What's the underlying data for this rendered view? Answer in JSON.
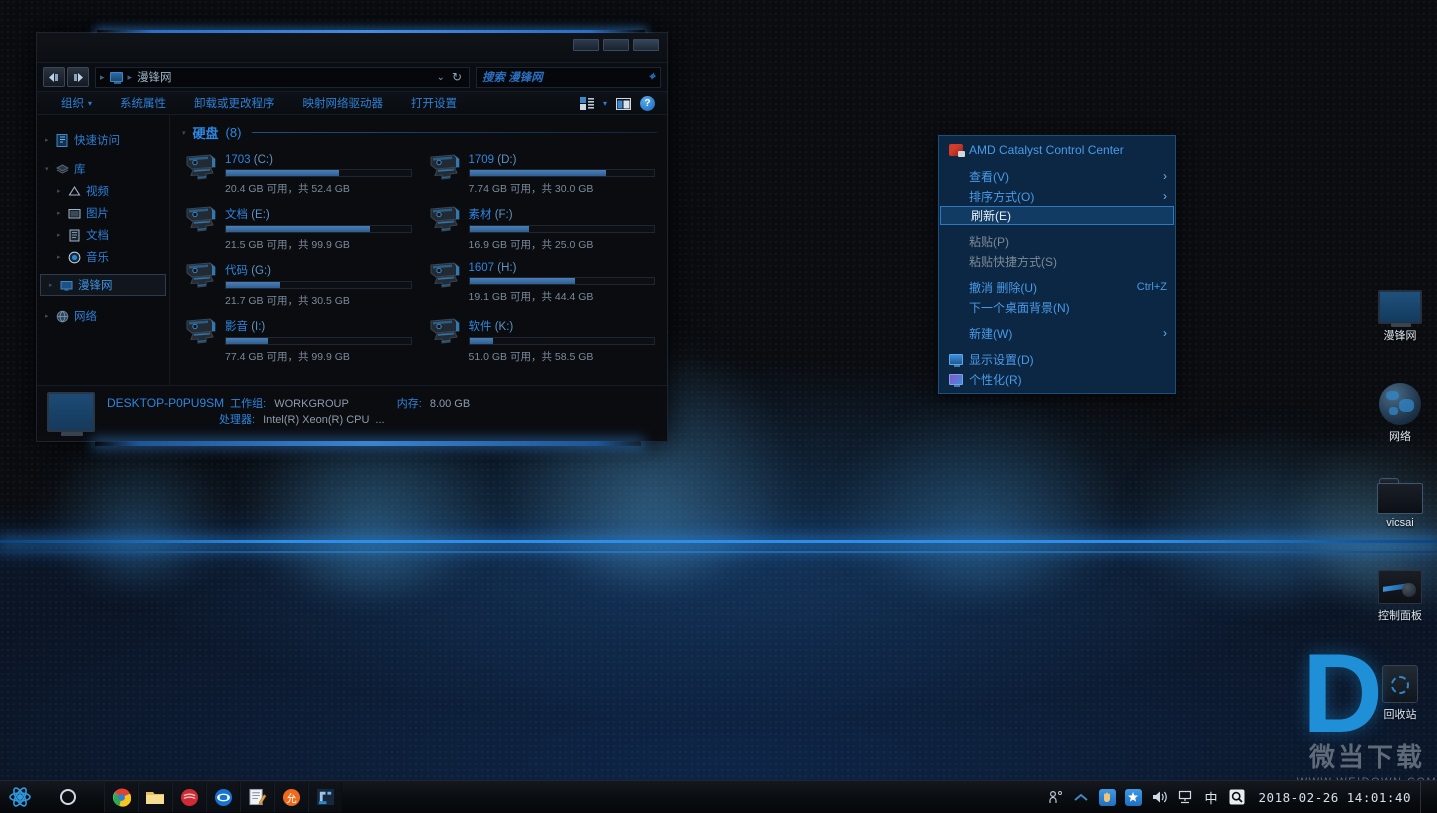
{
  "explorer": {
    "window_controls": [
      "minimize",
      "maximize",
      "close"
    ],
    "address": {
      "back_icon": "back-arrow-icon",
      "forward_icon": "forward-arrow-icon",
      "computer_icon": "computer-icon",
      "path": "漫锋网",
      "dropdown_icon": "chevron-down-icon",
      "refresh_icon": "refresh-icon",
      "search_placeholder": "搜索 漫锋网"
    },
    "commandbar": {
      "items": [
        {
          "label": "组织",
          "has_dropdown": true
        },
        {
          "label": "系统属性",
          "has_dropdown": false
        },
        {
          "label": "卸载或更改程序",
          "has_dropdown": false
        },
        {
          "label": "映射网络驱动器",
          "has_dropdown": false
        },
        {
          "label": "打开设置",
          "has_dropdown": false
        }
      ],
      "right_icons": [
        "view-layout-icon",
        "chevron-down-icon",
        "preview-pane-icon",
        "help-icon"
      ],
      "help_label": "?"
    },
    "navpane": {
      "items": [
        {
          "label": "快速访问",
          "icon": "quick-access-icon",
          "level": 1,
          "selected": false
        },
        {
          "label": "库",
          "icon": "library-icon",
          "level": 1,
          "selected": false
        },
        {
          "label": "视频",
          "icon": "videos-icon",
          "level": 2,
          "selected": false
        },
        {
          "label": "图片",
          "icon": "pictures-icon",
          "level": 2,
          "selected": false
        },
        {
          "label": "文档",
          "icon": "documents-icon",
          "level": 2,
          "selected": false
        },
        {
          "label": "音乐",
          "icon": "music-icon",
          "level": 2,
          "selected": false
        },
        {
          "label": "漫锋网",
          "icon": "computer-icon",
          "level": 1,
          "selected": true
        },
        {
          "label": "网络",
          "icon": "network-icon",
          "level": 1,
          "selected": false
        }
      ]
    },
    "group": {
      "title": "硬盘",
      "count": "(8)"
    },
    "drives": [
      {
        "name": "1703",
        "letter": "(C:)",
        "free": "20.4 GB 可用，共 52.4 GB",
        "used_pct": 61
      },
      {
        "name": "1709",
        "letter": "(D:)",
        "free": "7.74 GB 可用，共 30.0 GB",
        "used_pct": 74
      },
      {
        "name": "文档",
        "letter": "(E:)",
        "free": "21.5 GB 可用，共 99.9 GB",
        "used_pct": 78
      },
      {
        "name": "素材",
        "letter": "(F:)",
        "free": "16.9 GB 可用，共 25.0 GB",
        "used_pct": 32
      },
      {
        "name": "代码",
        "letter": "(G:)",
        "free": "21.7 GB 可用，共 30.5 GB",
        "used_pct": 29
      },
      {
        "name": "1607",
        "letter": "(H:)",
        "free": "19.1 GB 可用，共 44.4 GB",
        "used_pct": 57
      },
      {
        "name": "影音",
        "letter": "(I:)",
        "free": "77.4 GB 可用，共 99.9 GB",
        "used_pct": 23
      },
      {
        "name": "软件",
        "letter": "(K:)",
        "free": "51.0 GB 可用，共 58.5 GB",
        "used_pct": 13
      }
    ],
    "status": {
      "computer_name": "DESKTOP-P0PU9SM",
      "workgroup_label": "工作组:",
      "workgroup_value": "WORKGROUP",
      "memory_label": "内存:",
      "memory_value": "8.00 GB",
      "cpu_label": "处理器:",
      "cpu_value": "Intel(R) Xeon(R) CPU",
      "cpu_ellipsis": "..."
    }
  },
  "context_menu": {
    "items": [
      {
        "label": "AMD Catalyst Control Center",
        "icon": "amd-icon",
        "style": "link",
        "submenu": false,
        "accel": ""
      },
      {
        "label": "查看(V)",
        "icon": "",
        "style": "link",
        "submenu": true,
        "accel": ""
      },
      {
        "label": "排序方式(O)",
        "icon": "",
        "style": "link",
        "submenu": true,
        "accel": ""
      },
      {
        "label": "刷新(E)",
        "icon": "",
        "style": "highlight",
        "submenu": false,
        "accel": ""
      },
      {
        "label": "粘贴(P)",
        "icon": "",
        "style": "disabled",
        "submenu": false,
        "accel": ""
      },
      {
        "label": "粘贴快捷方式(S)",
        "icon": "",
        "style": "disabled",
        "submenu": false,
        "accel": ""
      },
      {
        "label": "撤消 删除(U)",
        "icon": "",
        "style": "link",
        "submenu": false,
        "accel": "Ctrl+Z"
      },
      {
        "label": "下一个桌面背景(N)",
        "icon": "",
        "style": "link",
        "submenu": false,
        "accel": ""
      },
      {
        "label": "新建(W)",
        "icon": "",
        "style": "link",
        "submenu": true,
        "accel": ""
      },
      {
        "label": "显示设置(D)",
        "icon": "display-settings-icon",
        "style": "link",
        "submenu": false,
        "accel": ""
      },
      {
        "label": "个性化(R)",
        "icon": "personalize-icon",
        "style": "link",
        "submenu": false,
        "accel": ""
      }
    ]
  },
  "desktop_icons": [
    {
      "label": "漫锋网",
      "icon": "computer-icon"
    },
    {
      "label": "网络",
      "icon": "network-globe-icon"
    },
    {
      "label": "vicsai",
      "icon": "folder-icon"
    },
    {
      "label": "控制面板",
      "icon": "control-panel-icon"
    },
    {
      "label": "回收站",
      "icon": "recycle-bin-icon"
    }
  ],
  "watermark": {
    "logo": "D",
    "title": "微当下载",
    "url": "WWW.WEIDOWN.COM"
  },
  "taskbar": {
    "start_icon": "start-atom-icon",
    "cortana_icon": "cortana-circle-icon",
    "buttons": [
      {
        "icon": "chrome-icon",
        "name": "chrome"
      },
      {
        "icon": "file-explorer-icon",
        "name": "file-explorer"
      },
      {
        "icon": "red-app-icon",
        "name": "red-app"
      },
      {
        "icon": "teamviewer-icon",
        "name": "teamviewer"
      },
      {
        "icon": "notepad-icon",
        "name": "notepad"
      },
      {
        "icon": "orange-app-icon",
        "name": "orange-app"
      },
      {
        "icon": "blue-app-icon",
        "name": "blue-app"
      }
    ],
    "tray": {
      "people_icon": "people-icon",
      "expand_icon": "chevron-up-icon",
      "icons": [
        "hand-badge-icon",
        "star-badge-icon",
        "volume-icon",
        "network-icon",
        "ime-icon",
        "action-center-icon"
      ],
      "ime_label": "中",
      "date": "2018-02-26",
      "time": "14:01:40"
    }
  },
  "colors": {
    "accent_blue": "#2e86e0",
    "link_blue": "#4a9ae8",
    "menu_bg": "#0b2744",
    "menu_highlight": "#123b63",
    "window_bg": "#0a0c10",
    "bar_fill": "#3f6f9f"
  }
}
